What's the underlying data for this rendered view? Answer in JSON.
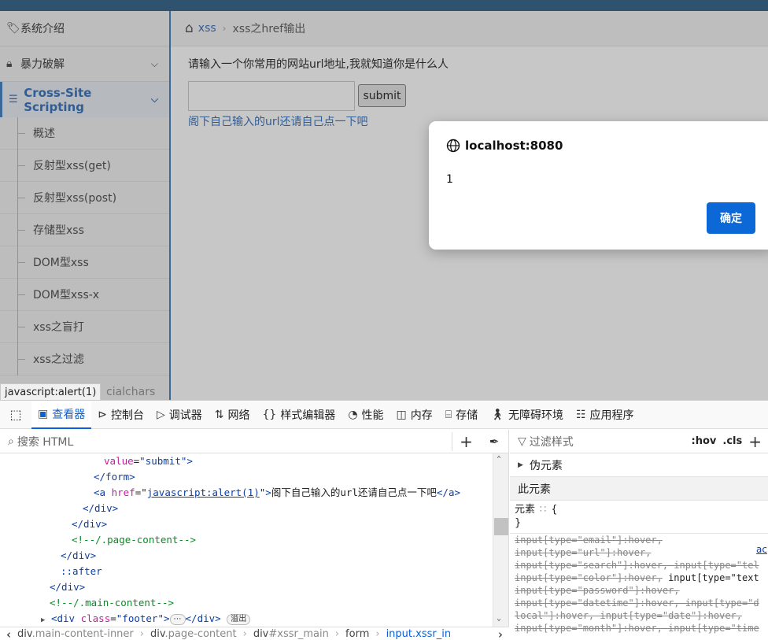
{
  "sidebar": {
    "items": [
      {
        "label": "系统介绍",
        "icon": "tag-icon"
      },
      {
        "label": "暴力破解",
        "icon": "lock-icon"
      }
    ],
    "active_section": {
      "label": "Cross-Site Scripting",
      "icon": "tree-icon"
    },
    "sub_items": [
      "概述",
      "反射型xss(get)",
      "反射型xss(post)",
      "存储型xss",
      "DOM型xss",
      "DOM型xss-x",
      "xss之盲打",
      "xss之过滤"
    ],
    "partial_item": "cialchars"
  },
  "breadcrumb": {
    "home_icon": "home-icon",
    "link": "xss",
    "current": "xss之href输出"
  },
  "page": {
    "prompt": "请输入一个你常用的网站url地址,我就知道你是什么人",
    "input_value": "",
    "submit_label": "submit",
    "result_link": "阁下自己输入的url还请自己点一下吧"
  },
  "alert": {
    "origin": "localhost:8080",
    "message": "1",
    "ok_label": "确定"
  },
  "status_tooltip": "javascript:alert(1)",
  "devtools": {
    "tabs": [
      {
        "label": "查看器",
        "icon": "inspector-icon",
        "active": true
      },
      {
        "label": "控制台",
        "icon": "console-icon"
      },
      {
        "label": "调试器",
        "icon": "debugger-icon"
      },
      {
        "label": "网络",
        "icon": "network-icon"
      },
      {
        "label": "样式编辑器",
        "icon": "style-editor-icon"
      },
      {
        "label": "性能",
        "icon": "performance-icon"
      },
      {
        "label": "内存",
        "icon": "memory-icon"
      },
      {
        "label": "存储",
        "icon": "storage-icon"
      },
      {
        "label": "无障碍环境",
        "icon": "accessibility-icon"
      },
      {
        "label": "应用程序",
        "icon": "application-icon"
      }
    ],
    "search_placeholder": "搜索 HTML",
    "html_lines": {
      "l1_attr": "value",
      "l1_val": "\"submit\"",
      "l2_tag": "</form>",
      "l3_attr": "href",
      "l3_val": "javascript:alert(1)",
      "l3_text": "阁下自己输入的url还请自己点一下吧",
      "l4_tag": "</div>",
      "l5_tag": "</div>",
      "l6_comment": "<!--/.page-content-->",
      "l7_tag": "</div>",
      "l8_pseudo": "::after",
      "l9_tag": "</div>",
      "l10_comment": "<!--/.main-content-->",
      "l11_attr": "class",
      "l11_val": "\"footer\"",
      "l11_badge": "溢出"
    },
    "breadcrumbs": [
      {
        "tag": "div",
        "cls": ".main-content-inner"
      },
      {
        "tag": "div",
        "cls": ".page-content"
      },
      {
        "tag": "div",
        "cls": "#xssr_main"
      },
      {
        "tag": "form",
        "cls": ""
      },
      {
        "tag": "input",
        "cls": ".xssr_in"
      }
    ],
    "rules": {
      "filter_placeholder": "过滤样式",
      "hov": ":hov",
      "cls": ".cls",
      "pseudo_label": "伪元素",
      "this_element": "此元素",
      "element_label": "元素",
      "open_brace": "{",
      "close_brace": "}",
      "source_link": "ac",
      "selector_lines": [
        [
          "input[type=\"email\"]:hover,",
          ""
        ],
        [
          "input[type=\"url\"]:hover,",
          ""
        ],
        [
          "input[type=\"search\"]:hover,",
          " input[type=\"tel"
        ],
        [
          "input[type=\"color\"]:hover,",
          " input[type=\"text"
        ],
        [
          "input[type=\"password\"]:hover,",
          ""
        ],
        [
          "input[type=\"datetime\"]:hover,",
          " input[type=\"d"
        ],
        [
          "local\"]:hover,",
          " input[type=\"date\"]:hover,"
        ],
        [
          "input[type=\"month\"]:hover,",
          " input[type=\"time"
        ]
      ]
    }
  }
}
